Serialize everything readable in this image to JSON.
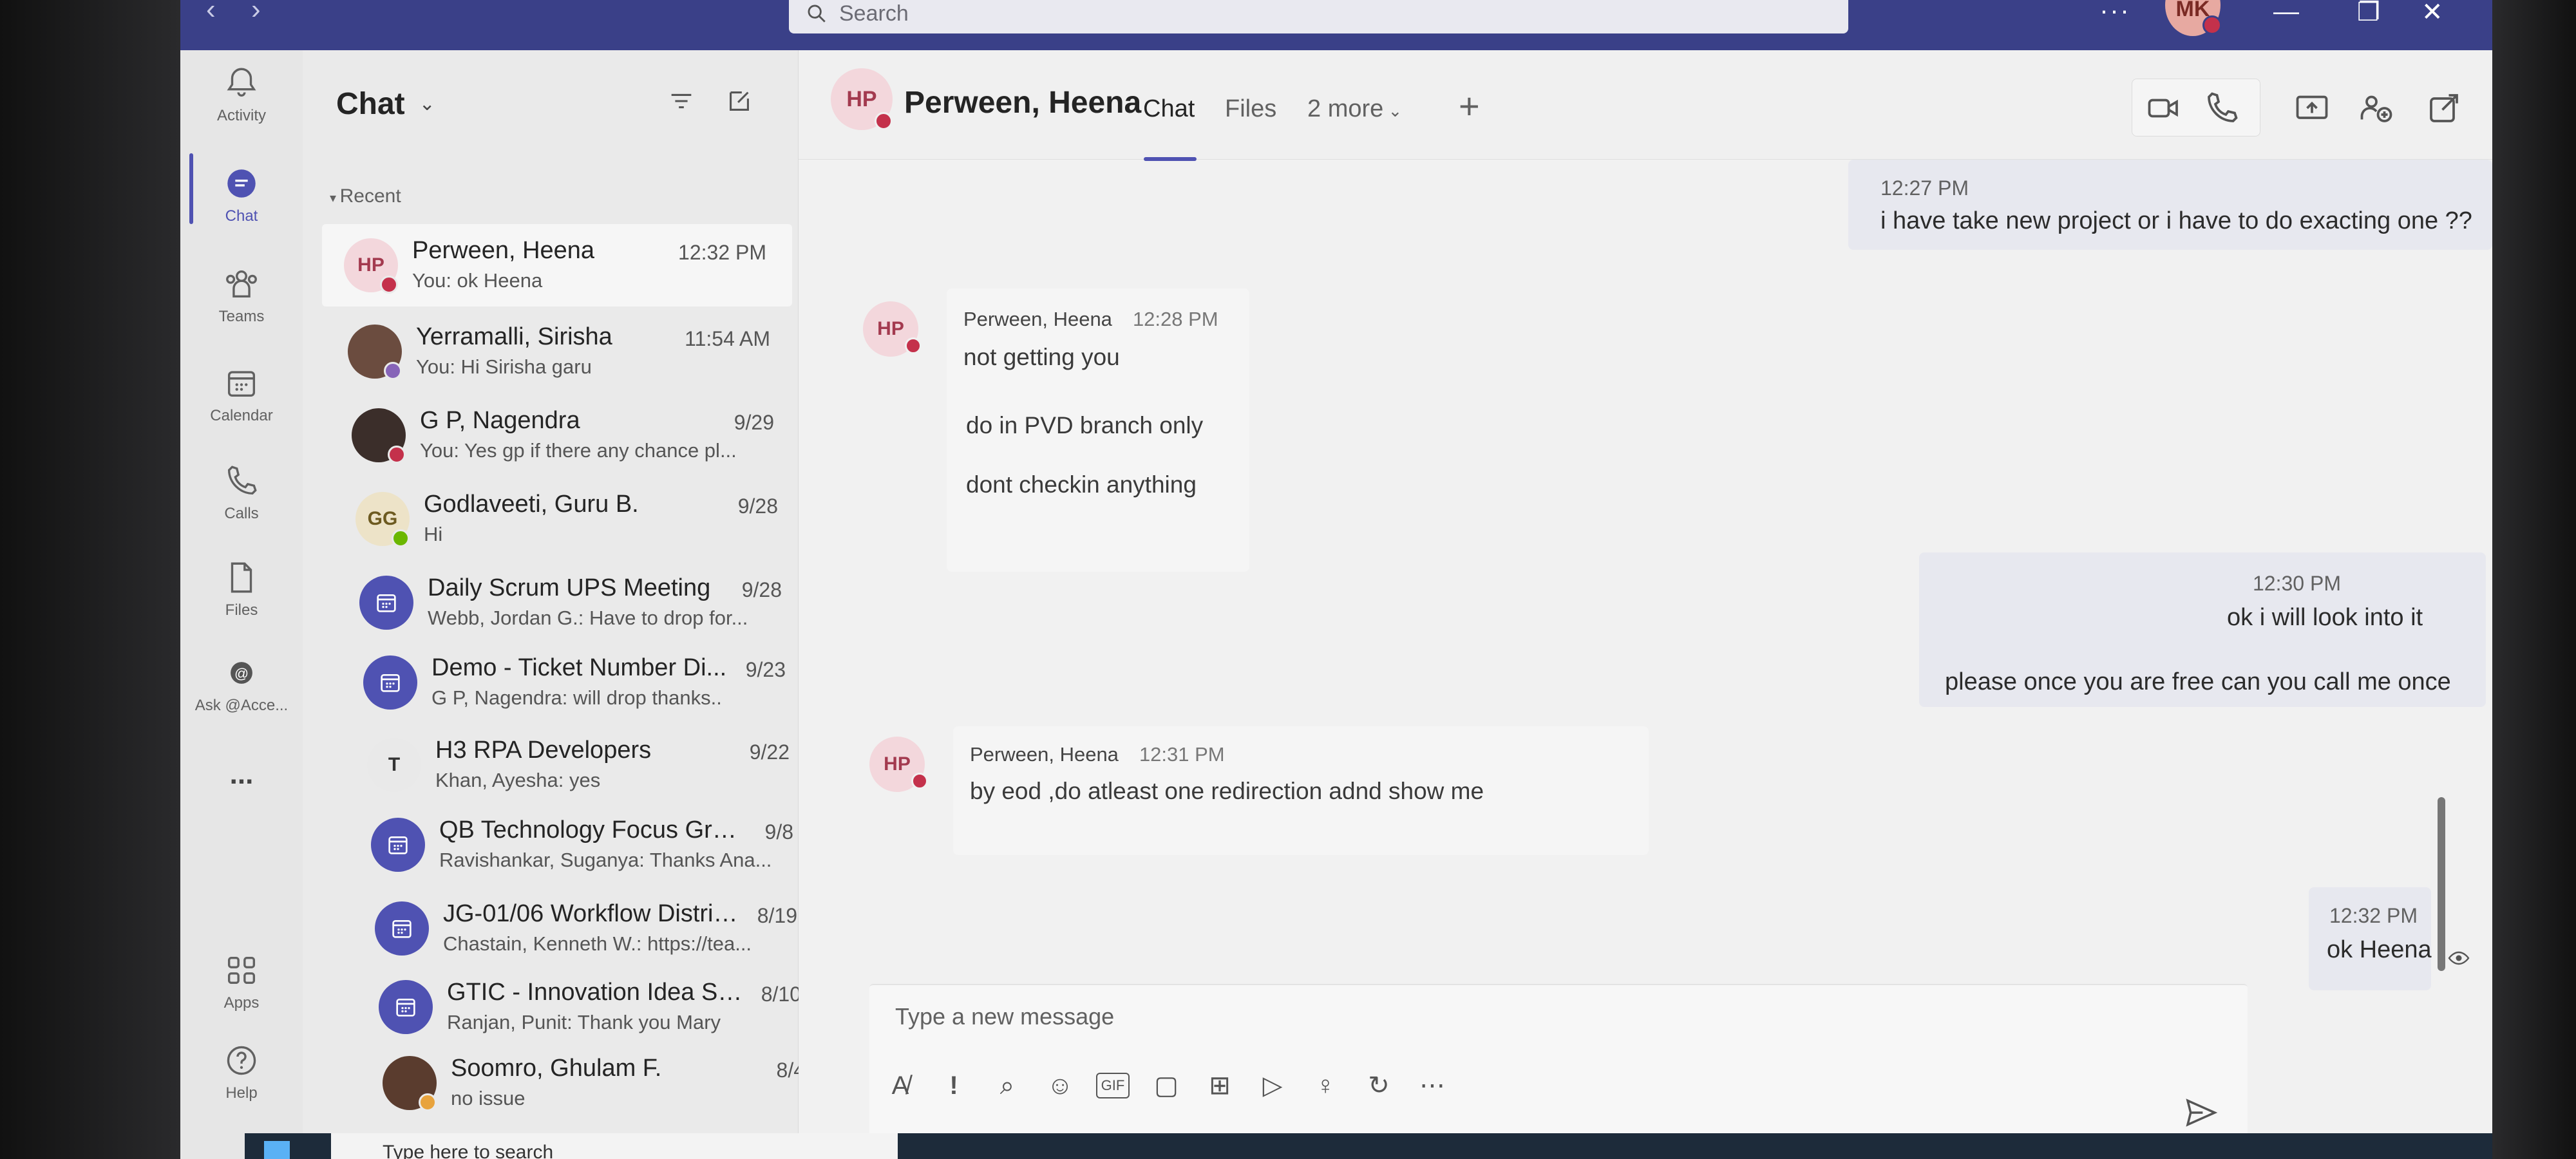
{
  "titlebar": {
    "back": "‹",
    "forward": "›",
    "search_placeholder": "Search",
    "more": "···",
    "avatar_initials": "MK",
    "minimize": "—",
    "restore": "❐",
    "close": "✕"
  },
  "rail": {
    "items": [
      {
        "label": "Activity",
        "icon": "bell-icon"
      },
      {
        "label": "Chat",
        "icon": "chat-icon"
      },
      {
        "label": "Teams",
        "icon": "teams-icon"
      },
      {
        "label": "Calendar",
        "icon": "calendar-icon"
      },
      {
        "label": "Calls",
        "icon": "phone-icon"
      },
      {
        "label": "Files",
        "icon": "file-icon"
      },
      {
        "label": "Ask @Acce...",
        "icon": "at-icon"
      },
      {
        "label": "...",
        "icon": "more-icon"
      },
      {
        "label": "Apps",
        "icon": "apps-icon"
      },
      {
        "label": "Help",
        "icon": "help-icon"
      }
    ],
    "active": "Chat"
  },
  "chatlist": {
    "title": "Chat",
    "section": "Recent",
    "conversations": [
      {
        "initials": "HP",
        "name": "Perween, Heena",
        "preview": "You: ok Heena",
        "time": "12:32 PM",
        "presence": "#c4314b",
        "avatar_bg": "#f3d7dc",
        "avatar_fg": "#a33a4f"
      },
      {
        "initials": "",
        "name": "Yerramalli, Sirisha",
        "preview": "You: Hi Sirisha garu",
        "time": "11:54 AM",
        "presence": "#8764b8",
        "avatar_bg": "#6b4c3f",
        "avatar_fg": "#ffffff"
      },
      {
        "initials": "",
        "name": "G P, Nagendra",
        "preview": "You: Yes gp if there any chance pl...",
        "time": "9/29",
        "presence": "#c4314b",
        "avatar_bg": "#3b2e2a",
        "avatar_fg": "#ffffff"
      },
      {
        "initials": "GG",
        "name": "Godlaveeti, Guru B.",
        "preview": "Hi",
        "time": "9/28",
        "presence": "#6bb700",
        "avatar_bg": "#ede3c8",
        "avatar_fg": "#6d5a20"
      },
      {
        "initials": "",
        "name": "Daily Scrum UPS Meeting",
        "preview": "Webb, Jordan G.: Have to drop for...",
        "time": "9/28",
        "presence": "",
        "avatar_bg": "#4f52b2",
        "avatar_fg": "#ffffff"
      },
      {
        "initials": "",
        "name": "Demo - Ticket Number Di...",
        "preview": "G P, Nagendra: will drop thanks..",
        "time": "9/23",
        "presence": "",
        "avatar_bg": "#4f52b2",
        "avatar_fg": "#ffffff"
      },
      {
        "initials": "T",
        "name": "H3 RPA Developers",
        "preview": "Khan, Ayesha: yes",
        "time": "9/22",
        "presence": "",
        "avatar_bg": "#e9e9e9",
        "avatar_fg": "#333333"
      },
      {
        "initials": "",
        "name": "QB Technology Focus Grou...",
        "preview": "Ravishankar, Suganya: Thanks Ana...",
        "time": "9/8",
        "presence": "",
        "avatar_bg": "#4f52b2",
        "avatar_fg": "#ffffff"
      },
      {
        "initials": "",
        "name": "JG-01/06 Workflow Distrib...",
        "preview": "Chastain, Kenneth W.: https://tea...",
        "time": "8/19",
        "presence": "",
        "avatar_bg": "#4f52b2",
        "avatar_fg": "#ffffff"
      },
      {
        "initials": "",
        "name": "GTIC - Innovation Idea Su...",
        "preview": "Ranjan, Punit: Thank you Mary",
        "time": "8/10",
        "presence": "",
        "avatar_bg": "#4f52b2",
        "avatar_fg": "#ffffff"
      },
      {
        "initials": "",
        "name": "Soomro, Ghulam F.",
        "preview": "no issue",
        "time": "8/4",
        "presence": "#e8a33d",
        "avatar_bg": "#5a3c2e",
        "avatar_fg": "#ffffff"
      }
    ]
  },
  "header": {
    "initials": "HP",
    "name": "Perween, Heena",
    "tabs": [
      "Chat",
      "Files",
      "2 more"
    ],
    "active_tab": "Chat",
    "add_tab": "+"
  },
  "messages": {
    "out1": {
      "time": "12:27 PM",
      "text": "i have take new project or i have to do exacting one ??"
    },
    "in1": {
      "sender": "Perween, Heena",
      "time": "12:28 PM",
      "lines": [
        "not getting you",
        "do in PVD branch only",
        "dont checkin anything"
      ]
    },
    "out2": {
      "time": "12:30 PM",
      "lines": [
        "ok i will look into it",
        "please once you are free can you call me once"
      ]
    },
    "in2": {
      "sender": "Perween, Heena",
      "time": "12:31 PM",
      "text": "by eod ,do atleast one redirection adnd show me"
    },
    "out3": {
      "time": "12:32 PM",
      "text": "ok Heena"
    }
  },
  "compose": {
    "placeholder": "Type a new message"
  },
  "taskbar": {
    "search_placeholder": "Type here to search"
  }
}
